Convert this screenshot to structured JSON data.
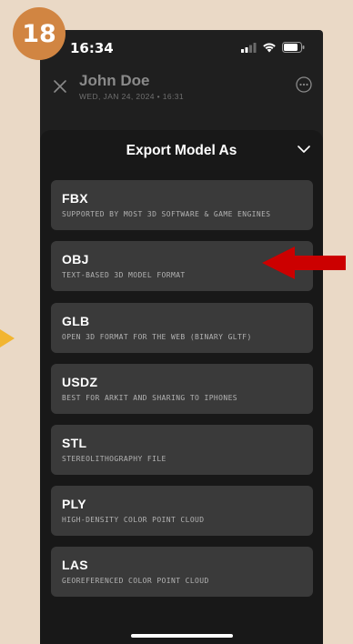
{
  "step_badge": "18",
  "status_bar": {
    "time": "16:34"
  },
  "header": {
    "name": "John Doe",
    "date": "WED, JAN 24, 2024 • 16:31"
  },
  "sheet": {
    "title": "Export Model As",
    "options": [
      {
        "label": "FBX",
        "description": "SUPPORTED BY MOST 3D SOFTWARE & GAME ENGINES"
      },
      {
        "label": "OBJ",
        "description": "TEXT-BASED 3D MODEL FORMAT"
      },
      {
        "label": "GLB",
        "description": "OPEN 3D FORMAT FOR THE WEB (BINARY GLTF)"
      },
      {
        "label": "USDZ",
        "description": "BEST FOR ARKIT AND SHARING TO IPHONES"
      },
      {
        "label": "STL",
        "description": "STEREOLITHOGRAPHY FILE"
      },
      {
        "label": "PLY",
        "description": "HIGH-DENSITY COLOR POINT CLOUD"
      },
      {
        "label": "LAS",
        "description": "GEOREFERENCED COLOR POINT CLOUD"
      }
    ]
  },
  "colors": {
    "badge": "#d18542",
    "annotation_arrow": "#cc0000",
    "side_pointer": "#f2b530",
    "background": "#ead9c6"
  },
  "icons": [
    "close-icon",
    "more-icon",
    "chevron-down-icon",
    "signal-icon",
    "wifi-icon",
    "battery-icon"
  ]
}
